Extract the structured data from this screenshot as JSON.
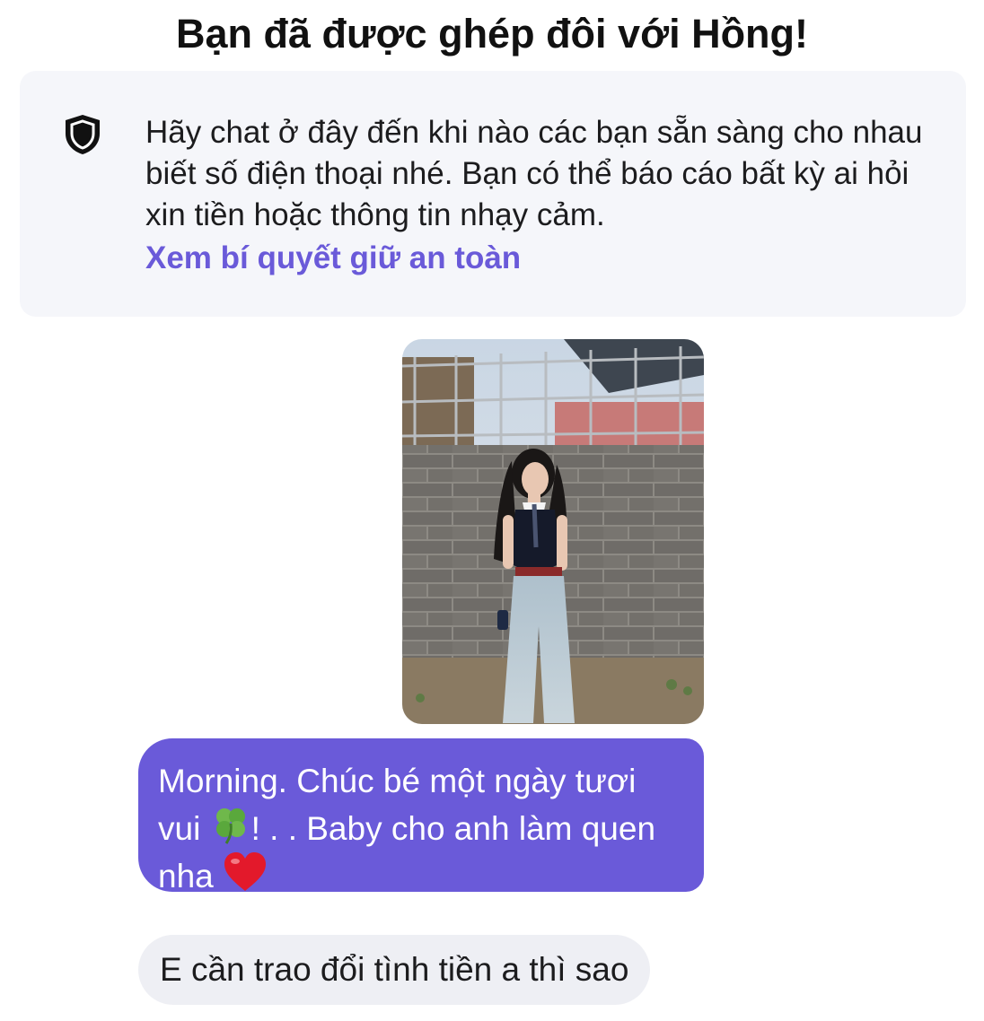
{
  "header": {
    "title": "Bạn đã được ghép đôi với Hồng!"
  },
  "safety_notice": {
    "icon": "shield-icon",
    "message": "Hãy chat ở đây đến khi nào các bạn sẵn sàng cho nhau biết số điện thoại nhé. Bạn có thể báo cáo bất kỳ ai hỏi xin tiền hoặc thông tin nhạy cảm.",
    "link_label": "Xem bí quyết giữ an toàn"
  },
  "messages": [
    {
      "type": "photo",
      "direction": "sent",
      "alt": ""
    },
    {
      "type": "text",
      "direction": "sent",
      "text_before_emoji": "Morning. Chúc bé một ngày tươi vui ",
      "emoji_1": "four-leaf-clover-icon",
      "text_middle": "! . . Baby cho anh làm quen nha ",
      "emoji_2": "red-heart-icon"
    },
    {
      "type": "text",
      "direction": "received",
      "text": "E cần trao đổi tình tiền a thì sao"
    }
  ],
  "colors": {
    "accent": "#6a5ad9",
    "card_background": "#f5f6fa",
    "received_bubble": "#eeeff4",
    "text": "#1c1c1e"
  }
}
